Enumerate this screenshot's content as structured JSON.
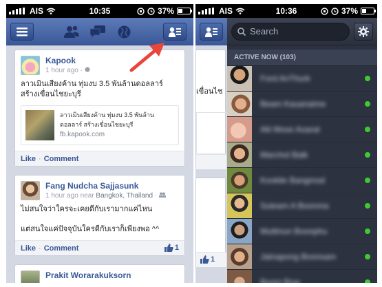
{
  "left": {
    "status": {
      "carrier": "AIS",
      "time": "10:35",
      "battery": "37%"
    },
    "posts": [
      {
        "author": "Kapook",
        "time": "1 hour ago",
        "text": "ลาวเมินเสียงค้าน ทุ่มงบ 3.5 พันล้านดอลลาร์ สร้างเขื่อนไชยะบุรี",
        "link_title": "ลาวเมินเสียงค้าน ทุ่มงบ 3.5 พันล้านดอลลาร์ สร้างเขื่อนไชยะบุรี",
        "link_domain": "fb.kapook.com",
        "like": "Like",
        "comment": "Comment"
      },
      {
        "author": "Fang Nudcha Sajjasunk",
        "time": "1 hour ago",
        "near": "near",
        "place": "Bangkok, Thailand",
        "text1": "ไม่สนใจว่าใครจะเคยดีกับเรามากแค่ไหน",
        "text2": "แต่สนใจแค่ปัจจุบันใครดีกับเราก็เพียงพอ ^^",
        "like": "Like",
        "comment": "Comment",
        "likes_count": "1"
      },
      {
        "author": "Prakit Worarakuksorn"
      }
    ]
  },
  "right": {
    "status": {
      "carrier": "AIS",
      "time": "10:36",
      "battery": "37%"
    },
    "search": {
      "placeholder": "Search"
    },
    "section_header": "ACTIVE NOW (103)",
    "friends": [
      {
        "name": "Ford AnThurk",
        "online": true
      },
      {
        "name": "Beam Kauanaime",
        "online": true
      },
      {
        "name": "Alii Mose Aoarat",
        "online": true
      },
      {
        "name": "Marchol Balk",
        "online": true
      },
      {
        "name": "Kooklie Bangmod",
        "online": true
      },
      {
        "name": "Suteam A Boonma",
        "online": true
      },
      {
        "name": "Muttinun Boonphu",
        "online": true
      },
      {
        "name": "Jatnapong Boonsam",
        "online": true
      },
      {
        "name": "Boom Bow",
        "online": true
      }
    ],
    "peek_texts": [
      "เขื่อนไช",
      "เขื่อนไช"
    ],
    "peek_like": "Like",
    "peek_likes_count": "1"
  },
  "colors": {
    "fb_blue": "#3b5998",
    "online_green": "#3ecb2e",
    "annotation_arrow": "#e8463b"
  }
}
